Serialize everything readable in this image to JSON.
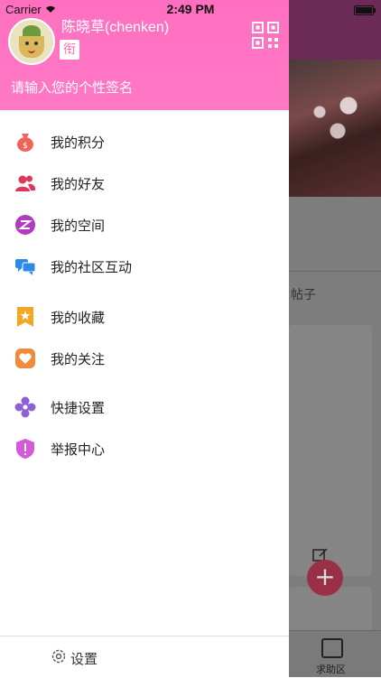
{
  "status_bar": {
    "carrier": "Carrier",
    "time": "2:49 PM"
  },
  "profile": {
    "username": "陈晓草(chenken)",
    "tag": "衔",
    "signature_placeholder": "请输入您的个性签名"
  },
  "menu": {
    "items": [
      {
        "label": "我的积分",
        "icon": "money-bag-icon",
        "color": "#f0625a"
      },
      {
        "label": "我的好友",
        "icon": "friends-icon",
        "color": "#e0365c"
      },
      {
        "label": "我的空间",
        "icon": "space-icon",
        "color": "#b23cc0"
      },
      {
        "label": "我的社区互动",
        "icon": "chat-bubbles-icon",
        "color": "#2b8ae6"
      },
      {
        "label": "我的收藏",
        "icon": "bookmark-icon",
        "color": "#f5a623"
      },
      {
        "label": "我的关注",
        "icon": "heart-icon",
        "color": "#f08a3c"
      },
      {
        "label": "快捷设置",
        "icon": "flower-settings-icon",
        "color": "#8e5fd6"
      },
      {
        "label": "举报中心",
        "icon": "shield-alert-icon",
        "color": "#d45ad8"
      }
    ]
  },
  "footer": {
    "settings_label": "设置"
  },
  "background_page": {
    "posts_label": "帖子",
    "tab_help_label": "求助区"
  }
}
